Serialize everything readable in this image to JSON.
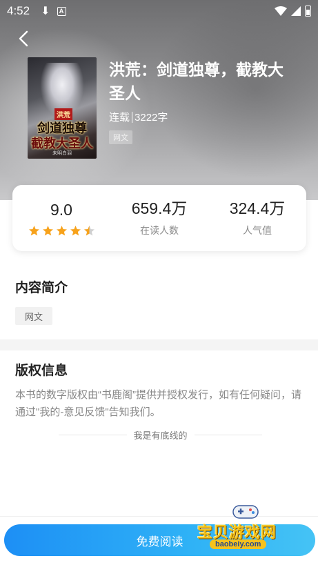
{
  "status_bar": {
    "time": "4:52",
    "notification_icons": [
      "download-icon",
      "a-icon"
    ],
    "right_icons": [
      "wifi-icon",
      "signal-icon",
      "battery-icon"
    ]
  },
  "header": {
    "back_icon": "chevron-left-icon"
  },
  "book": {
    "title": "洪荒：剑道独尊，截教大圣人",
    "status": "连载",
    "word_count": "3222字",
    "category_tag": "网文",
    "cover": {
      "tag": "洪荒",
      "title_line1": "剑道独尊",
      "title_line2": "截教大圣人",
      "author": "未明白羽"
    }
  },
  "stats": {
    "rating": "9.0",
    "rating_stars": 4.5,
    "readers_value": "659.4万",
    "readers_label": "在读人数",
    "popularity_value": "324.4万",
    "popularity_label": "人气值"
  },
  "intro": {
    "title": "内容简介",
    "tag": "网文"
  },
  "copyright": {
    "title": "版权信息",
    "text": "本书的数字版权由“书鹿阁”提供并授权发行，如有任何疑问，请通过\"我的-意见反馈\"告知我们。",
    "bottom_text": "我是有底线的"
  },
  "footer": {
    "read_button": "免费阅读"
  },
  "watermark": {
    "text": "宝贝游戏网",
    "url": "baobeiy.com"
  },
  "colors": {
    "primary_button": "#1d8ff5",
    "star": "#f7a21b",
    "muted_text": "#888888"
  }
}
